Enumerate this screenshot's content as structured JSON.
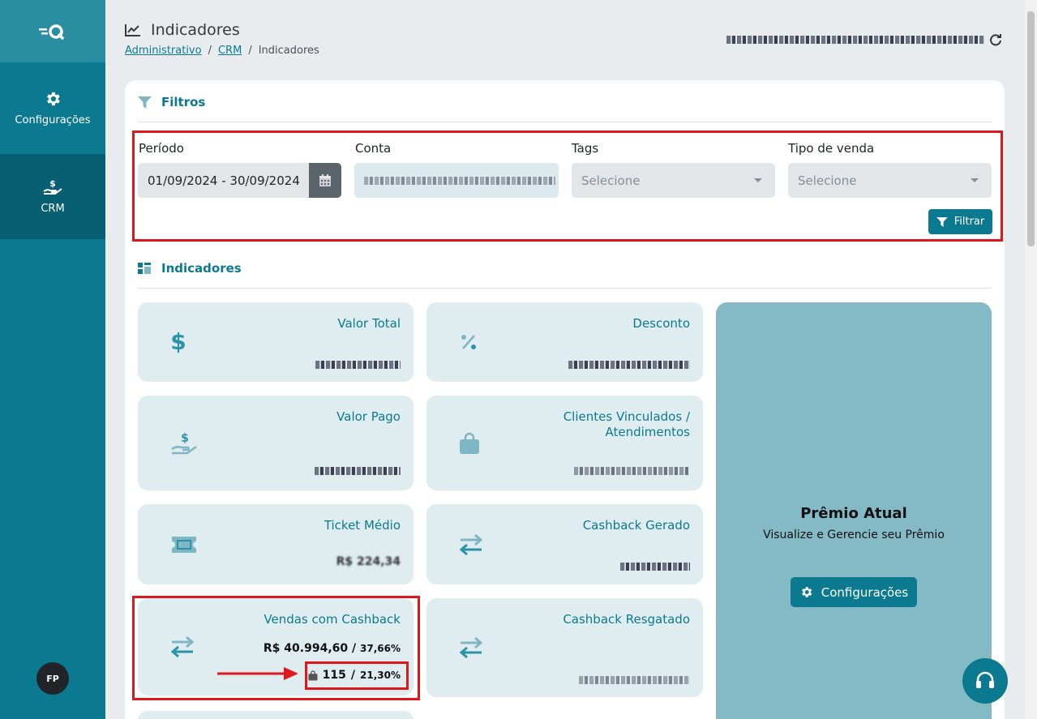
{
  "sidebar": {
    "items": [
      {
        "label": "Configurações",
        "icon": "gear-icon"
      },
      {
        "label": "CRM",
        "icon": "dollar-hand-icon"
      }
    ],
    "avatar": "FP"
  },
  "header": {
    "title": "Indicadores",
    "breadcrumb": [
      "Administrativo",
      "CRM",
      "Indicadores"
    ],
    "separator": "/"
  },
  "filters": {
    "heading": "Filtros",
    "periodo_label": "Período",
    "periodo_value": "01/09/2024 - 30/09/2024",
    "conta_label": "Conta",
    "tags_label": "Tags",
    "tags_placeholder": "Selecione",
    "tipo_label": "Tipo de venda",
    "tipo_placeholder": "Selecione",
    "filtrar_label": "Filtrar"
  },
  "indicators": {
    "heading": "Indicadores",
    "valor_total": "Valor Total",
    "desconto": "Desconto",
    "valor_pago": "Valor Pago",
    "clientes": "Clientes Vinculados / Atendimentos",
    "ticket_medio": "Ticket Médio",
    "ticket_medio_value": "R$ 224,34",
    "cashback_gerado": "Cashback Gerado",
    "vendas_cashback": "Vendas com Cashback",
    "vendas_value": "R$ 40.994,60",
    "vendas_pct": "37,66%",
    "vendas_count": "115",
    "vendas_count_pct": "21,30%",
    "cashback_resgatado": "Cashback Resgatado"
  },
  "premio": {
    "title": "Prêmio Atual",
    "subtitle": "Visualize e Gerencie seu Prêmio",
    "button": "Configurações"
  },
  "colors": {
    "primary": "#0b7a90",
    "highlight": "#e0161b",
    "card_bg": "#e0edf0",
    "premio_bg": "#84bac6"
  }
}
